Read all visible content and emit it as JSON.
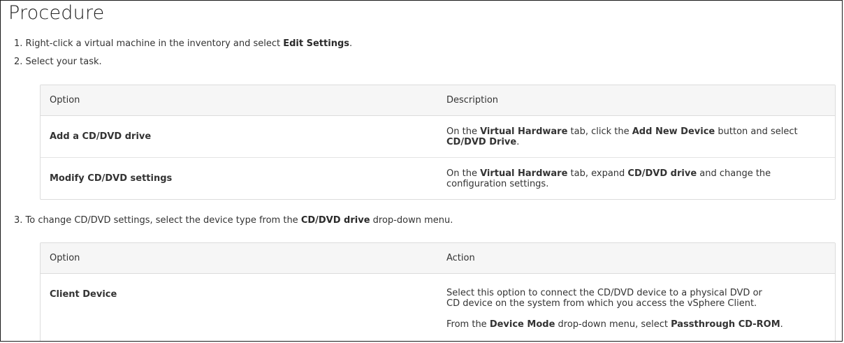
{
  "heading": "Procedure",
  "steps": [
    {
      "num": "1.",
      "text_before": "Right-click a virtual machine in the inventory and select ",
      "bold": "Edit Settings",
      "text_after": "."
    },
    {
      "num": "2.",
      "text": "Select your task."
    },
    {
      "num": "3.",
      "text_before": "To change CD/DVD settings, select the device type from the ",
      "bold": "CD/DVD drive",
      "text_after": " drop-down menu."
    }
  ],
  "table1": {
    "headers": [
      "Option",
      "Description"
    ],
    "rows": [
      {
        "option": "Add a CD/DVD drive",
        "d1": "On the ",
        "b1": "Virtual Hardware",
        "d2": " tab, click the ",
        "b2": "Add New Device",
        "d3": " button and select ",
        "b3": "CD/DVD Drive",
        "d4": "."
      },
      {
        "option": "Modify CD/DVD settings",
        "d1": "On the ",
        "b1": "Virtual Hardware",
        "d2": " tab, expand ",
        "b2": "CD/DVD drive",
        "d3": " and change the ",
        "d4": "configuration settings."
      }
    ]
  },
  "table2": {
    "headers": [
      "Option",
      "Action"
    ],
    "rows": [
      {
        "option": "Client Device",
        "p1a": "Select this option to connect the CD/DVD device to a physical DVD or",
        "p1b": "CD device on the system from which you access the vSphere Client.",
        "p2a": "From the ",
        "p2b": "Device Mode",
        "p2c": " drop-down menu, select ",
        "p2d": "Passthrough CD-ROM",
        "p2e": "."
      }
    ]
  }
}
